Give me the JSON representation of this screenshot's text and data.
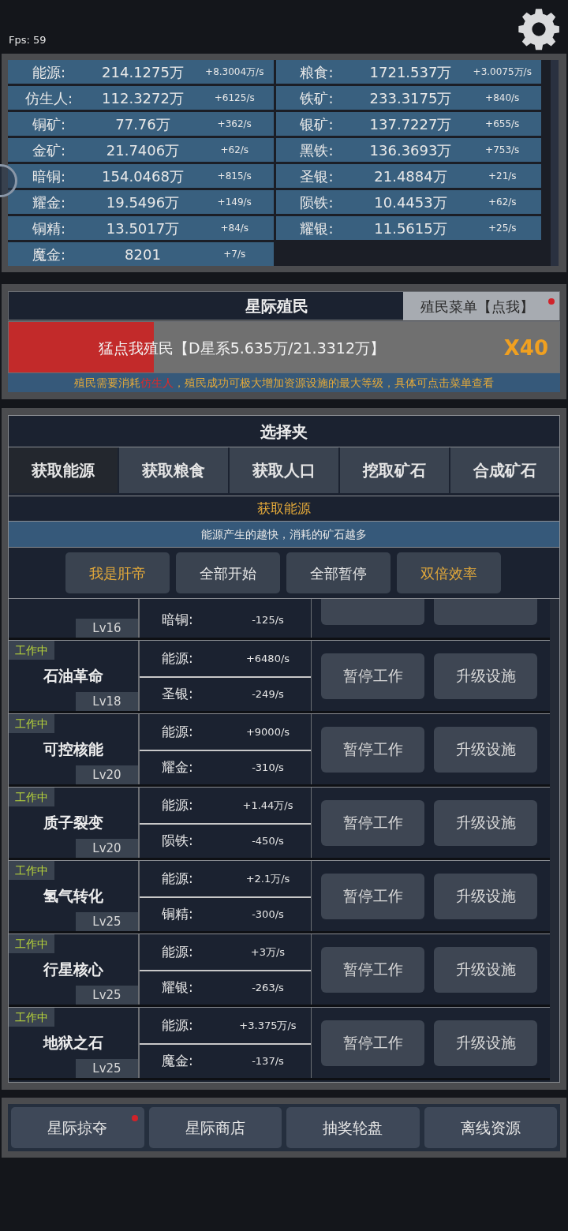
{
  "fps": "Fps: 59",
  "resources": [
    {
      "name": "能源:",
      "amount": "214.1275万",
      "rate": "+8.3004万/s"
    },
    {
      "name": "粮食:",
      "amount": "1721.537万",
      "rate": "+3.0075万/s"
    },
    {
      "name": "仿生人:",
      "amount": "112.3272万",
      "rate": "+6125/s"
    },
    {
      "name": "铁矿:",
      "amount": "233.3175万",
      "rate": "+840/s"
    },
    {
      "name": "铜矿:",
      "amount": "77.76万",
      "rate": "+362/s"
    },
    {
      "name": "银矿:",
      "amount": "137.7227万",
      "rate": "+655/s"
    },
    {
      "name": "金矿:",
      "amount": "21.7406万",
      "rate": "+62/s"
    },
    {
      "name": "黑铁:",
      "amount": "136.3693万",
      "rate": "+753/s"
    },
    {
      "name": "暗铜:",
      "amount": "154.0468万",
      "rate": "+815/s"
    },
    {
      "name": "圣银:",
      "amount": "21.4884万",
      "rate": "+21/s"
    },
    {
      "name": "耀金:",
      "amount": "19.5496万",
      "rate": "+149/s"
    },
    {
      "name": "陨铁:",
      "amount": "10.4453万",
      "rate": "+62/s"
    },
    {
      "name": "铜精:",
      "amount": "13.5017万",
      "rate": "+84/s"
    },
    {
      "name": "耀银:",
      "amount": "11.5615万",
      "rate": "+25/s"
    },
    {
      "name": "魔金:",
      "amount": "8201",
      "rate": "+7/s"
    }
  ],
  "colony": {
    "title": "星际殖民",
    "menu_button": {
      "label": "殖民菜单【点我】",
      "badge": true
    },
    "progress": {
      "label": "猛点我殖民【D星系5.635万/21.3312万】",
      "level": 0.264,
      "multiplier": "X40"
    },
    "info": [
      {
        "text": "殖民需要消耗",
        "kind": "normal"
      },
      {
        "text": "仿生人",
        "kind": "highlight"
      },
      {
        "text": "，殖民成功可极大增加资源设施的最大等级，具体可点击菜单查看",
        "kind": "normal"
      }
    ]
  },
  "selector": {
    "title": "选择夹",
    "tabs": [
      {
        "label": "获取能源",
        "selected": true
      },
      {
        "label": "获取粮食",
        "selected": false
      },
      {
        "label": "获取人口",
        "selected": false
      },
      {
        "label": "挖取矿石",
        "selected": false
      },
      {
        "label": "合成矿石",
        "selected": false
      }
    ],
    "section_title": "获取能源",
    "description": "能源产生的越快，消耗的矿石越多",
    "actions": [
      {
        "label": "我是肝帝",
        "highlighted": true
      },
      {
        "label": "全部开始",
        "highlighted": false
      },
      {
        "label": "全部暂停",
        "highlighted": false
      },
      {
        "label": "双倍效率",
        "highlighted": true
      }
    ],
    "facilities": [
      {
        "kind": "cut",
        "level": "Lv16",
        "resources": [
          {
            "name": "暗铜:",
            "rate": "-125/s"
          }
        ]
      },
      {
        "kind": "full",
        "status": "工作中",
        "name": "石油革命",
        "level": "Lv18",
        "resources": [
          {
            "name": "能源:",
            "rate": "+6480/s"
          },
          {
            "name": "圣银:",
            "rate": "-249/s"
          }
        ],
        "buttons": [
          "暂停工作",
          "升级设施"
        ]
      },
      {
        "kind": "full",
        "status": "工作中",
        "name": "可控核能",
        "level": "Lv20",
        "resources": [
          {
            "name": "能源:",
            "rate": "+9000/s"
          },
          {
            "name": "耀金:",
            "rate": "-310/s"
          }
        ],
        "buttons": [
          "暂停工作",
          "升级设施"
        ]
      },
      {
        "kind": "full",
        "status": "工作中",
        "name": "质子裂变",
        "level": "Lv20",
        "resources": [
          {
            "name": "能源:",
            "rate": "+1.44万/s"
          },
          {
            "name": "陨铁:",
            "rate": "-450/s"
          }
        ],
        "buttons": [
          "暂停工作",
          "升级设施"
        ]
      },
      {
        "kind": "full",
        "status": "工作中",
        "name": "氢气转化",
        "level": "Lv25",
        "resources": [
          {
            "name": "能源:",
            "rate": "+2.1万/s"
          },
          {
            "name": "铜精:",
            "rate": "-300/s"
          }
        ],
        "buttons": [
          "暂停工作",
          "升级设施"
        ]
      },
      {
        "kind": "full",
        "status": "工作中",
        "name": "行星核心",
        "level": "Lv25",
        "resources": [
          {
            "name": "能源:",
            "rate": "+3万/s"
          },
          {
            "name": "耀银:",
            "rate": "-263/s"
          }
        ],
        "buttons": [
          "暂停工作",
          "升级设施"
        ]
      },
      {
        "kind": "full",
        "status": "工作中",
        "name": "地狱之石",
        "level": "Lv25",
        "resources": [
          {
            "name": "能源:",
            "rate": "+3.375万/s"
          },
          {
            "name": "魔金:",
            "rate": "-137/s"
          }
        ],
        "buttons": [
          "暂停工作",
          "升级设施"
        ]
      }
    ]
  },
  "bottom_buttons": [
    {
      "label": "星际掠夺",
      "badge": true
    },
    {
      "label": "星际商店"
    },
    {
      "label": "抽奖轮盘"
    },
    {
      "label": "离线资源"
    }
  ]
}
